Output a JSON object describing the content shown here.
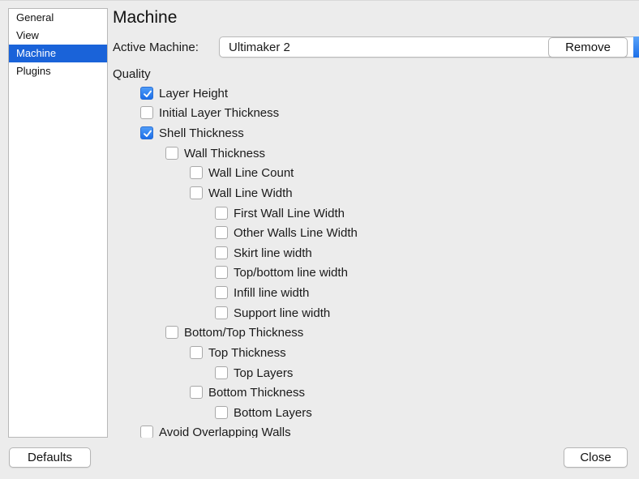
{
  "sidebar": {
    "items": [
      {
        "label": "General",
        "active": false
      },
      {
        "label": "View",
        "active": false
      },
      {
        "label": "Machine",
        "active": true
      },
      {
        "label": "Plugins",
        "active": false
      }
    ]
  },
  "main": {
    "title": "Machine",
    "active_machine_label": "Active Machine:",
    "active_machine_value": "Ultimaker 2",
    "remove_label": "Remove",
    "section_label": "Quality",
    "settings": [
      {
        "label": "Layer Height",
        "checked": true
      },
      {
        "label": "Initial Layer Thickness",
        "checked": false
      },
      {
        "label": "Shell Thickness",
        "checked": true
      },
      {
        "label": "Wall Thickness",
        "checked": false
      },
      {
        "label": "Wall Line Count",
        "checked": false
      },
      {
        "label": "Wall Line Width",
        "checked": false
      },
      {
        "label": "First Wall Line Width",
        "checked": false
      },
      {
        "label": "Other Walls Line Width",
        "checked": false
      },
      {
        "label": "Skirt line width",
        "checked": false
      },
      {
        "label": "Top/bottom line width",
        "checked": false
      },
      {
        "label": "Infill line width",
        "checked": false
      },
      {
        "label": "Support line width",
        "checked": false
      },
      {
        "label": "Bottom/Top Thickness",
        "checked": false
      },
      {
        "label": "Top Thickness",
        "checked": false
      },
      {
        "label": "Top Layers",
        "checked": false
      },
      {
        "label": "Bottom Thickness",
        "checked": false
      },
      {
        "label": "Bottom Layers",
        "checked": false
      },
      {
        "label": "Avoid Overlapping Walls",
        "checked": false
      }
    ]
  },
  "footer": {
    "defaults_label": "Defaults",
    "close_label": "Close"
  },
  "colors": {
    "accent": "#1a63d9",
    "window_bg": "#ececec"
  }
}
